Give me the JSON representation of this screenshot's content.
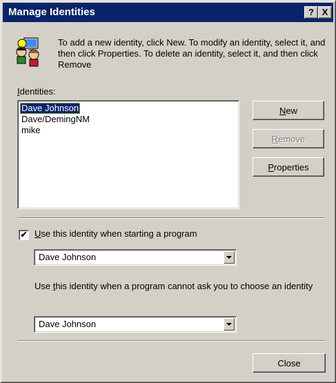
{
  "window": {
    "title": "Manage Identities",
    "help_label": "?",
    "close_label": "X"
  },
  "info": {
    "text": "To add a new identity, click New.  To modify an identity, select it, and then click Properties.  To delete an identity, select it, and then click Remove"
  },
  "identities": {
    "label_first": "I",
    "label_rest": "dentities:",
    "items": [
      "Dave Johnson",
      "Dave/DemingNM",
      "mike"
    ],
    "selected_index": 0
  },
  "buttons": {
    "new_first": "N",
    "new_rest": "ew",
    "remove_first": "R",
    "remove_rest": "emove",
    "properties_first": "P",
    "properties_rest": "roperties",
    "close": "Close"
  },
  "startup": {
    "checkbox_mark": "✔",
    "checked": true,
    "label_first": "U",
    "label_rest": "se this identity when starting a program",
    "value": "Dave Johnson"
  },
  "fallback": {
    "label_before": "Use ",
    "label_underlined": "t",
    "label_after": "his identity when a program cannot ask you to choose an identity",
    "value": "Dave Johnson"
  }
}
